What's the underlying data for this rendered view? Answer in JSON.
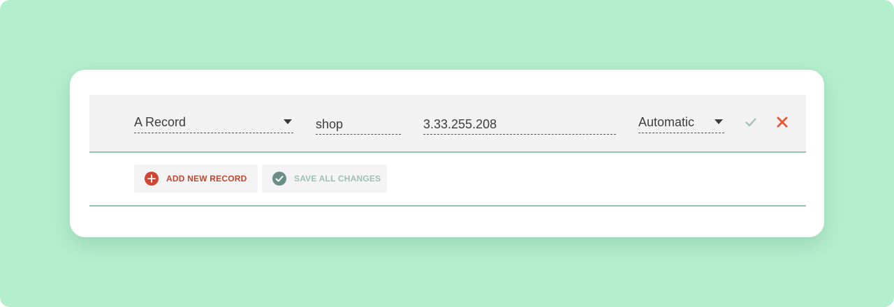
{
  "record": {
    "type": {
      "value": "A Record",
      "icon": "chevron-down-icon"
    },
    "name": {
      "value": "shop"
    },
    "value": {
      "value": "3.33.255.208"
    },
    "ttl": {
      "value": "Automatic",
      "icon": "chevron-down-icon"
    },
    "confirm_icon": "checkmark-icon",
    "cancel_icon": "close-icon"
  },
  "actions": {
    "add": {
      "label": "ADD NEW RECORD",
      "icon": "plus-circle-icon"
    },
    "save": {
      "label": "SAVE ALL CHANGES",
      "icon": "check-circle-icon"
    }
  },
  "colors": {
    "background": "#b3eecd",
    "accent_red": "#cf4632",
    "divider_teal": "#8fc1b6",
    "confirm_muted": "#9cbfb5"
  }
}
